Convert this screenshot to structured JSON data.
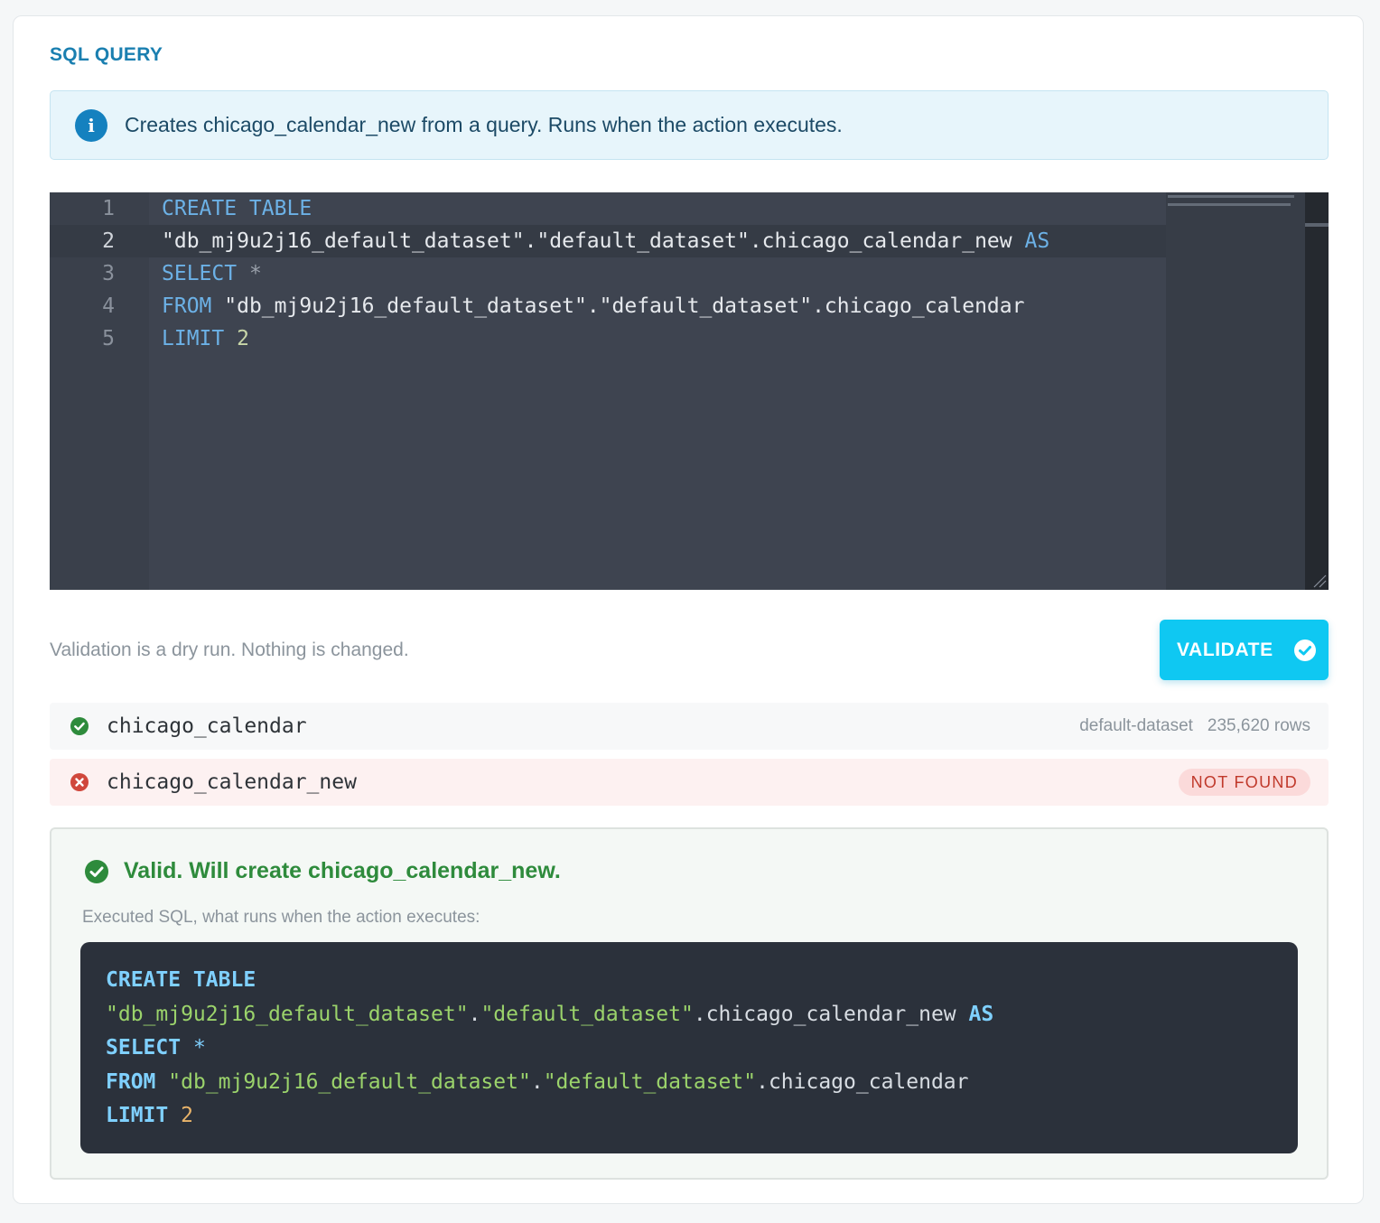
{
  "section_title": "SQL QUERY",
  "info": {
    "icon": "info-icon",
    "text": "Creates chicago_calendar_new from a query. Runs when the action executes."
  },
  "editor": {
    "lines": [
      {
        "num": "1",
        "parts": [
          {
            "t": "CREATE TABLE",
            "c": "kw"
          }
        ]
      },
      {
        "num": "2",
        "parts": [
          {
            "t": "\"db_mj9u2j16_default_dataset\".\"default_dataset\".chicago_calendar_new ",
            "c": ""
          },
          {
            "t": "AS",
            "c": "kw"
          }
        ]
      },
      {
        "num": "3",
        "parts": [
          {
            "t": "SELECT ",
            "c": "kw"
          },
          {
            "t": "*",
            "c": "sym"
          }
        ]
      },
      {
        "num": "4",
        "parts": [
          {
            "t": "FROM ",
            "c": "kw"
          },
          {
            "t": "\"db_mj9u2j16_default_dataset\".\"default_dataset\".chicago_calendar",
            "c": ""
          }
        ]
      },
      {
        "num": "5",
        "parts": [
          {
            "t": "LIMIT ",
            "c": "kw"
          },
          {
            "t": "2",
            "c": "num"
          }
        ]
      }
    ],
    "active_line": 2
  },
  "hint": "Validation is a dry run. Nothing is changed.",
  "validate_button": {
    "label": "VALIDATE",
    "icon": "check-circle-icon"
  },
  "tables": [
    {
      "status": "ok",
      "name": "chicago_calendar",
      "dataset": "default-dataset",
      "rows": "235,620 rows"
    },
    {
      "status": "error",
      "name": "chicago_calendar_new",
      "badge": "NOT FOUND"
    }
  ],
  "result": {
    "title": "Valid. Will create chicago_calendar_new.",
    "subtitle": "Executed SQL, what runs when the action executes:",
    "code_lines": [
      [
        {
          "t": "CREATE TABLE",
          "c": "ckw"
        }
      ],
      [
        {
          "t": "\"db_mj9u2j16_default_dataset\"",
          "c": "cstr"
        },
        {
          "t": ".",
          "c": "cdot"
        },
        {
          "t": "\"default_dataset\"",
          "c": "cstr"
        },
        {
          "t": ".chicago_calendar_new ",
          "c": "cdot"
        },
        {
          "t": "AS",
          "c": "ckw"
        }
      ],
      [
        {
          "t": "SELECT ",
          "c": "ckw"
        },
        {
          "t": "*",
          "c": "csym"
        }
      ],
      [
        {
          "t": "FROM ",
          "c": "ckw"
        },
        {
          "t": "\"db_mj9u2j16_default_dataset\"",
          "c": "cstr"
        },
        {
          "t": ".",
          "c": "cdot"
        },
        {
          "t": "\"default_dataset\"",
          "c": "cstr"
        },
        {
          "t": ".chicago_calendar",
          "c": "cdot"
        }
      ],
      [
        {
          "t": "LIMIT ",
          "c": "ckw"
        },
        {
          "t": "2",
          "c": "cnum"
        }
      ]
    ]
  },
  "colors": {
    "accent": "#0fc8f2",
    "title_blue": "#1a7fb0",
    "success": "#2e8b3c",
    "error": "#c0392b"
  }
}
